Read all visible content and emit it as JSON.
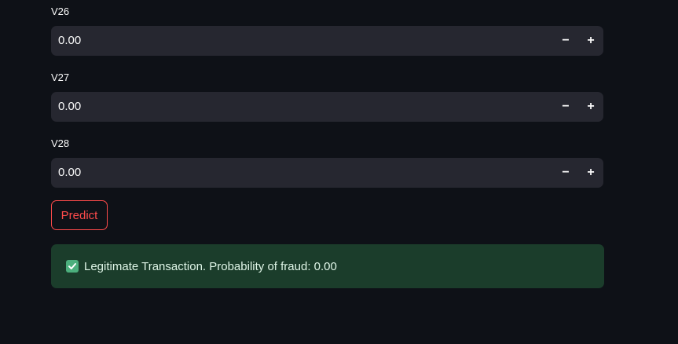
{
  "fields": [
    {
      "label": "V26",
      "value": "0.00",
      "minus": "−",
      "plus": "+"
    },
    {
      "label": "V27",
      "value": "0.00",
      "minus": "−",
      "plus": "+"
    },
    {
      "label": "V28",
      "value": "0.00",
      "minus": "−",
      "plus": "+"
    }
  ],
  "predict_button": {
    "label": "Predict"
  },
  "result": {
    "icon": "check-mark-icon",
    "text": "Legitimate Transaction. Probability of fraud: 0.00"
  },
  "colors": {
    "background": "#0e1117",
    "input_background": "#262730",
    "accent": "#ff4b4b",
    "success_background": "#1b3d2b",
    "success_icon": "#4caf7d"
  }
}
